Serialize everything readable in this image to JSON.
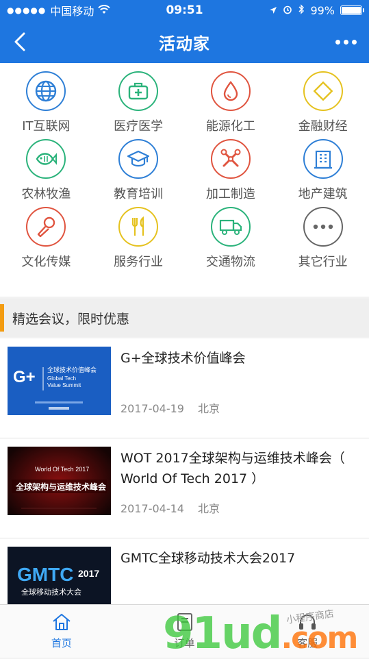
{
  "status_bar": {
    "carrier": "中国移动",
    "time": "09:51",
    "battery": "99%",
    "battery_level": 0.99
  },
  "navbar": {
    "title": "活动家"
  },
  "categories": [
    {
      "label": "IT互联网",
      "icon": "globe-icon",
      "color": "#2e7fd6"
    },
    {
      "label": "医疗医学",
      "icon": "medical-kit-icon",
      "color": "#2bb37b"
    },
    {
      "label": "能源化工",
      "icon": "drop-icon",
      "color": "#e0543f"
    },
    {
      "label": "金融财经",
      "icon": "diamond-icon",
      "color": "#e5c21f"
    },
    {
      "label": "农林牧渔",
      "icon": "fish-icon",
      "color": "#2bb37b"
    },
    {
      "label": "教育培训",
      "icon": "graduation-cap-icon",
      "color": "#2e7fd6"
    },
    {
      "label": "加工制造",
      "icon": "tools-icon",
      "color": "#e0543f"
    },
    {
      "label": "地产建筑",
      "icon": "building-icon",
      "color": "#2e7fd6"
    },
    {
      "label": "文化传媒",
      "icon": "microphone-icon",
      "color": "#e0543f"
    },
    {
      "label": "服务行业",
      "icon": "fork-knife-icon",
      "color": "#e5c21f"
    },
    {
      "label": "交通物流",
      "icon": "truck-icon",
      "color": "#2bb37b"
    },
    {
      "label": "其它行业",
      "icon": "more-icon",
      "color": "#666666"
    }
  ],
  "section": {
    "title": "精选会议，限时优惠"
  },
  "events": [
    {
      "name": "G+全球技术价值峰会",
      "date": "2017-04-19",
      "city": "北京",
      "thumb": {
        "big": "G+",
        "line1": "全球技术价值峰会",
        "line2": "Global Tech",
        "line3": "Value Summit"
      }
    },
    {
      "name": "WOT 2017全球架构与运维技术峰会（ World Of Tech 2017 ）",
      "date": "2017-04-14",
      "city": "北京",
      "thumb": {
        "big": "World Of Tech 2017",
        "line1": "全球架构与运维技术峰会"
      }
    },
    {
      "name": "GMTC全球移动技术大会2017",
      "date": "",
      "city": "",
      "thumb": {
        "big": "GMTC",
        "year": "2017",
        "line1": "全球移动技术大会"
      }
    }
  ],
  "tabbar": {
    "tabs": [
      {
        "label": "首页",
        "icon": "home-icon"
      },
      {
        "label": "订单",
        "icon": "order-icon"
      },
      {
        "label": "客服",
        "icon": "headset-icon"
      }
    ]
  },
  "watermark": {
    "main": "91ud",
    "suffix": ".com",
    "small": "小程序商店"
  }
}
